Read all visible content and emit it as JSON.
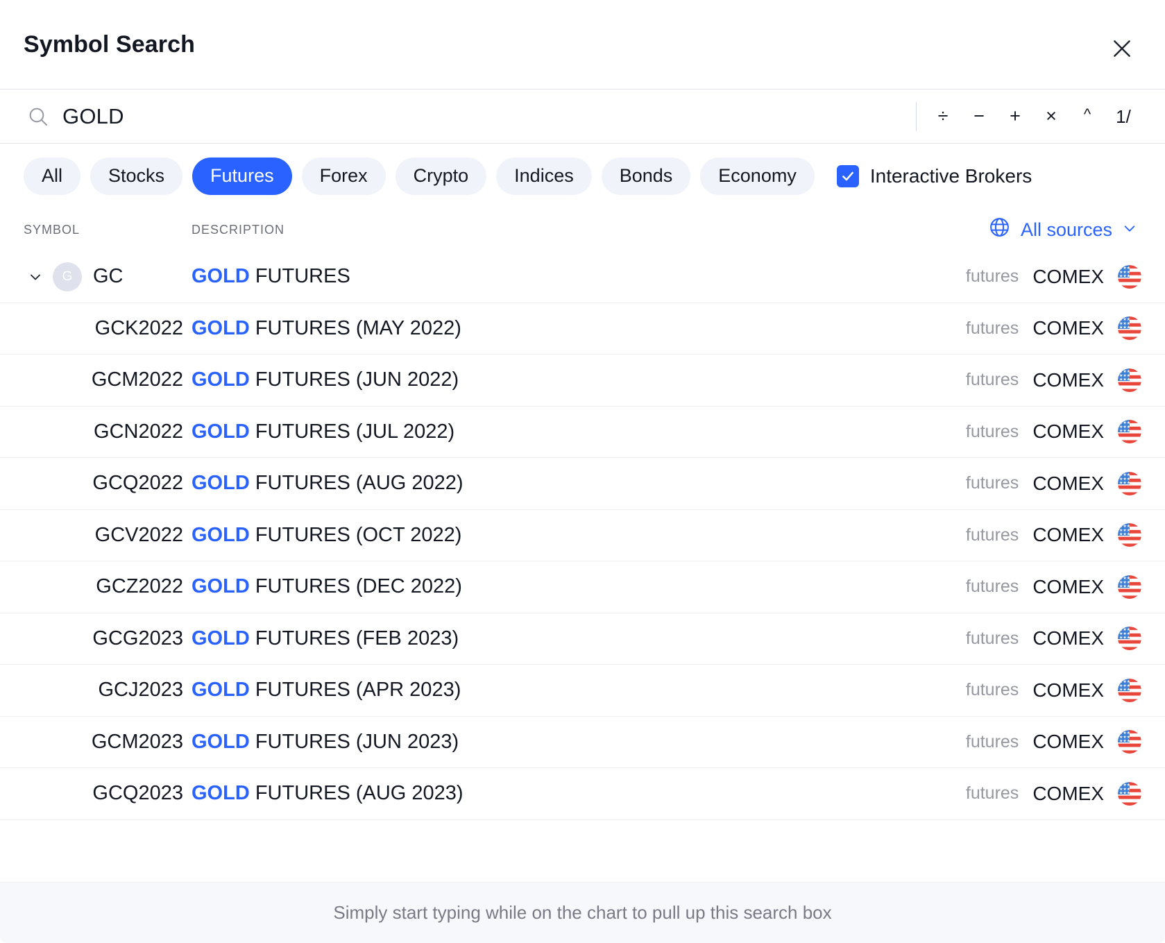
{
  "header": {
    "title": "Symbol Search",
    "close_icon": "close-icon"
  },
  "search": {
    "value": "GOLD",
    "placeholder": "Search",
    "icon": "search-icon",
    "operators": [
      {
        "name": "divide",
        "label": "÷"
      },
      {
        "name": "minus",
        "label": "−"
      },
      {
        "name": "plus",
        "label": "+"
      },
      {
        "name": "multiply",
        "label": "×"
      },
      {
        "name": "power",
        "label": "^"
      },
      {
        "name": "inverse",
        "label": "1/"
      }
    ]
  },
  "filters": {
    "tabs": [
      {
        "label": "All",
        "active": false
      },
      {
        "label": "Stocks",
        "active": false
      },
      {
        "label": "Futures",
        "active": true
      },
      {
        "label": "Forex",
        "active": false
      },
      {
        "label": "Crypto",
        "active": false
      },
      {
        "label": "Indices",
        "active": false
      },
      {
        "label": "Bonds",
        "active": false
      },
      {
        "label": "Economy",
        "active": false
      }
    ],
    "broker": {
      "label": "Interactive Brokers",
      "checked": true
    }
  },
  "columns": {
    "symbol": "SYMBOL",
    "description": "DESCRIPTION",
    "sources": "All sources",
    "sources_icon": "globe-icon",
    "sources_chevron": "chevron-down-icon"
  },
  "rows": [
    {
      "type": "parent",
      "expanded": true,
      "avatar": "G",
      "symbol": "GC",
      "desc_highlight": "GOLD",
      "desc_rest": " FUTURES",
      "market": "futures",
      "exchange": "COMEX",
      "flag": "us-flag-icon"
    },
    {
      "type": "child",
      "symbol": "GCK2022",
      "desc_highlight": "GOLD",
      "desc_rest": " FUTURES (MAY 2022)",
      "market": "futures",
      "exchange": "COMEX",
      "flag": "us-flag-icon"
    },
    {
      "type": "child",
      "symbol": "GCM2022",
      "desc_highlight": "GOLD",
      "desc_rest": " FUTURES (JUN 2022)",
      "market": "futures",
      "exchange": "COMEX",
      "flag": "us-flag-icon"
    },
    {
      "type": "child",
      "symbol": "GCN2022",
      "desc_highlight": "GOLD",
      "desc_rest": " FUTURES (JUL 2022)",
      "market": "futures",
      "exchange": "COMEX",
      "flag": "us-flag-icon"
    },
    {
      "type": "child",
      "symbol": "GCQ2022",
      "desc_highlight": "GOLD",
      "desc_rest": " FUTURES (AUG 2022)",
      "market": "futures",
      "exchange": "COMEX",
      "flag": "us-flag-icon"
    },
    {
      "type": "child",
      "symbol": "GCV2022",
      "desc_highlight": "GOLD",
      "desc_rest": " FUTURES (OCT 2022)",
      "market": "futures",
      "exchange": "COMEX",
      "flag": "us-flag-icon"
    },
    {
      "type": "child",
      "symbol": "GCZ2022",
      "desc_highlight": "GOLD",
      "desc_rest": " FUTURES (DEC 2022)",
      "market": "futures",
      "exchange": "COMEX",
      "flag": "us-flag-icon"
    },
    {
      "type": "child",
      "symbol": "GCG2023",
      "desc_highlight": "GOLD",
      "desc_rest": " FUTURES (FEB 2023)",
      "market": "futures",
      "exchange": "COMEX",
      "flag": "us-flag-icon"
    },
    {
      "type": "child",
      "symbol": "GCJ2023",
      "desc_highlight": "GOLD",
      "desc_rest": " FUTURES (APR 2023)",
      "market": "futures",
      "exchange": "COMEX",
      "flag": "us-flag-icon"
    },
    {
      "type": "child",
      "symbol": "GCM2023",
      "desc_highlight": "GOLD",
      "desc_rest": " FUTURES (JUN 2023)",
      "market": "futures",
      "exchange": "COMEX",
      "flag": "us-flag-icon"
    },
    {
      "type": "child",
      "symbol": "GCQ2023",
      "desc_highlight": "GOLD",
      "desc_rest": " FUTURES (AUG 2023)",
      "market": "futures",
      "exchange": "COMEX",
      "flag": "us-flag-icon"
    }
  ],
  "footer": {
    "hint": "Simply start typing while on the chart to pull up this search box"
  },
  "colors": {
    "accent": "#2962ff",
    "text": "#131722",
    "muted": "#787b86",
    "chip_bg": "#f0f3fa",
    "border": "#e0e3eb",
    "footer_bg": "#f7f8fc"
  }
}
